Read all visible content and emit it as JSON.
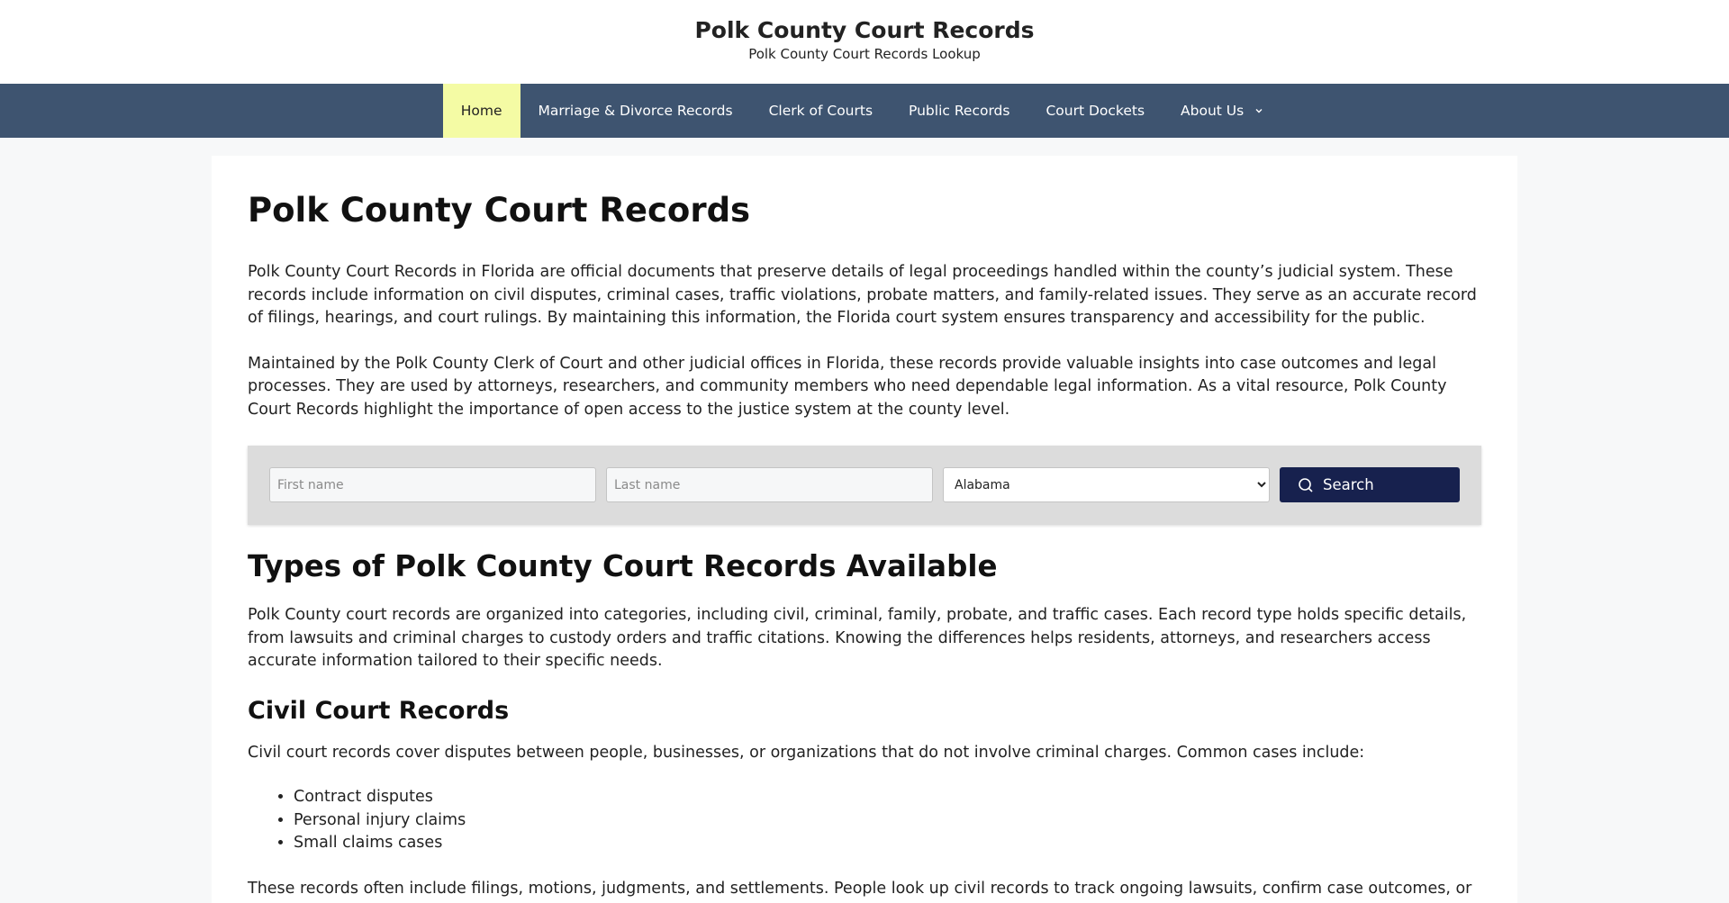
{
  "header": {
    "title": "Polk County Court Records",
    "tagline": "Polk County Court Records Lookup"
  },
  "nav": {
    "items": [
      {
        "label": "Home",
        "active": true
      },
      {
        "label": "Marriage & Divorce Records"
      },
      {
        "label": "Clerk of Courts"
      },
      {
        "label": "Public Records"
      },
      {
        "label": "Court Dockets"
      },
      {
        "label": "About Us",
        "has_dropdown": true
      }
    ]
  },
  "main": {
    "title": "Polk County Court Records",
    "intro_1": "Polk County Court Records in Florida are official documents that preserve details of legal proceedings handled within the county’s judicial system. These records include information on civil disputes, criminal cases, traffic violations, probate matters, and family-related issues. They serve as an accurate record of filings, hearings, and court rulings. By maintaining this information, the Florida court system ensures transparency and accessibility for the public.",
    "intro_2": "Maintained by the Polk County Clerk of Court and other judicial offices in Florida, these records provide valuable insights into case outcomes and legal processes. They are used by attorneys, researchers, and community members who need dependable legal information. As a vital resource, Polk County Court Records highlight the importance of open access to the justice system at the county level.",
    "types_title": "Types of Polk County Court Records Available",
    "types_text": "Polk County court records are organized into categories, including civil, criminal, family, probate, and traffic cases. Each record type holds specific details, from lawsuits and criminal charges to custody orders and traffic citations. Knowing the differences helps residents, attorneys, and researchers access accurate information tailored to their specific needs.",
    "civil_title": "Civil Court Records",
    "civil_text": "Civil court records cover disputes between people, businesses, or organizations that do not involve criminal charges. Common cases include:",
    "civil_cases": [
      "Contract disputes",
      "Personal injury claims",
      "Small claims cases"
    ],
    "civil_followup": "These records often include filings, motions, judgments, and settlements. People look up civil records to track ongoing lawsuits, confirm case outcomes, or"
  },
  "search": {
    "first_placeholder": "First name",
    "last_placeholder": "Last name",
    "state_value": "Alabama",
    "button_label": "Search"
  },
  "colors": {
    "nav_bg": "#3e5470",
    "nav_active_bg": "#f4fba4",
    "button_bg": "#17214e"
  }
}
